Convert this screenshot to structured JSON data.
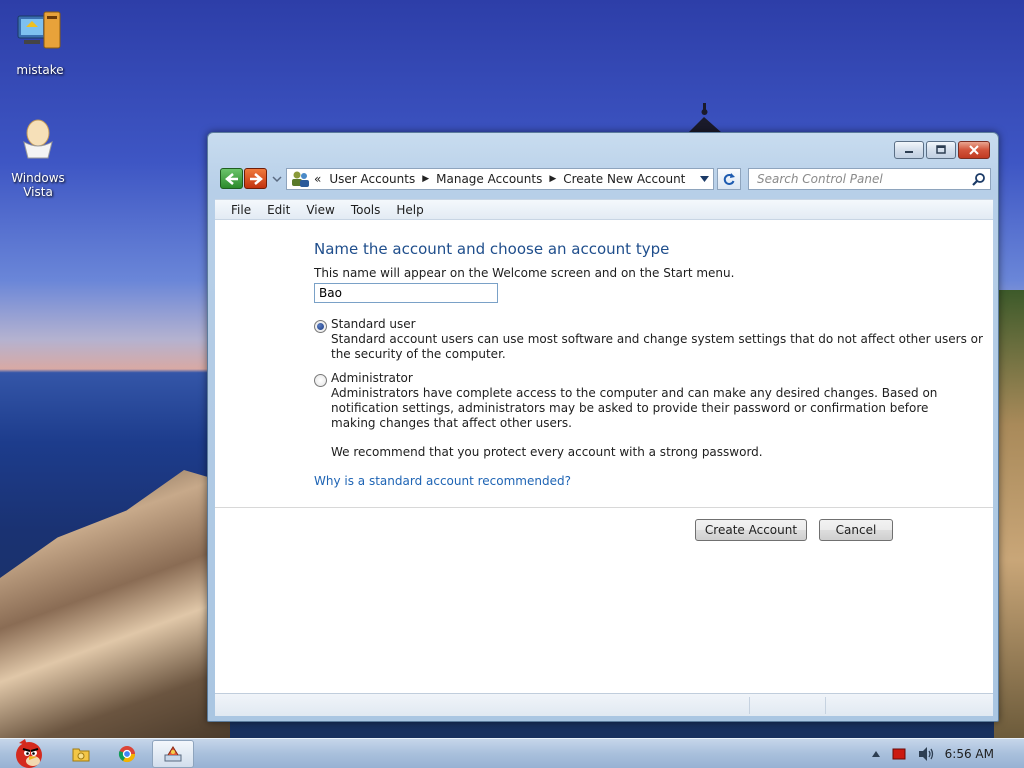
{
  "desktop": {
    "icons": [
      {
        "label": "mistake"
      },
      {
        "label_line1": "Windows",
        "label_line2": "Vista"
      }
    ]
  },
  "window": {
    "address": {
      "chevron": "«",
      "crumbs": [
        "User Accounts",
        "Manage Accounts",
        "Create New Account"
      ]
    },
    "search_placeholder": "Search Control Panel",
    "menu": [
      "File",
      "Edit",
      "View",
      "Tools",
      "Help"
    ],
    "content": {
      "title": "Name the account and choose an account type",
      "description": "This name will appear on the Welcome screen and on the Start menu.",
      "name_value": "Bao",
      "options": [
        {
          "label": "Standard user",
          "selected": true,
          "desc_lines": [
            "Standard account users can use most software and change system settings that do not affect other users or",
            "the security of the computer."
          ]
        },
        {
          "label": "Administrator",
          "selected": false,
          "desc_lines": [
            "Administrators have complete access to the computer and can make any desired changes. Based on",
            "notification settings, administrators may be asked to provide their password or confirmation before",
            "making changes that affect other users."
          ]
        }
      ],
      "recommendation": "We recommend that you protect every account with a strong password.",
      "help_link": "Why is a standard account recommended?",
      "create_button": "Create Account",
      "cancel_button": "Cancel"
    }
  },
  "taskbar": {
    "clock": "6:56 AM"
  },
  "colors": {
    "title_blue": "#1f4e8c",
    "link_blue": "#1e64b4",
    "close_red": "#c03a22"
  }
}
